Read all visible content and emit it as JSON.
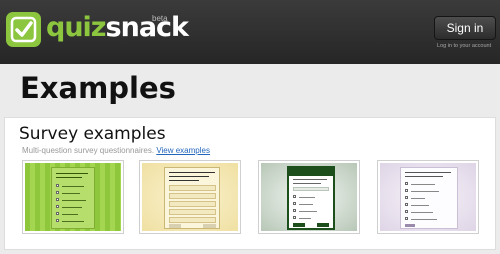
{
  "header": {
    "logo_text_a": "quiz",
    "logo_text_b": "snack",
    "beta": "beta",
    "signin_label": "Sign in",
    "login_hint": "Log in to your account"
  },
  "page": {
    "title": "Examples"
  },
  "survey_section": {
    "title": "Survey examples",
    "description": "Multi-question survey questionnaires.",
    "link_label": "View examples"
  },
  "thumbnails": [
    {
      "name": "green-striped-survey"
    },
    {
      "name": "cream-survey"
    },
    {
      "name": "green-frame-survey"
    },
    {
      "name": "lavender-survey"
    }
  ],
  "colors": {
    "brand_green": "#8cc63f",
    "link_blue": "#2266bb"
  }
}
